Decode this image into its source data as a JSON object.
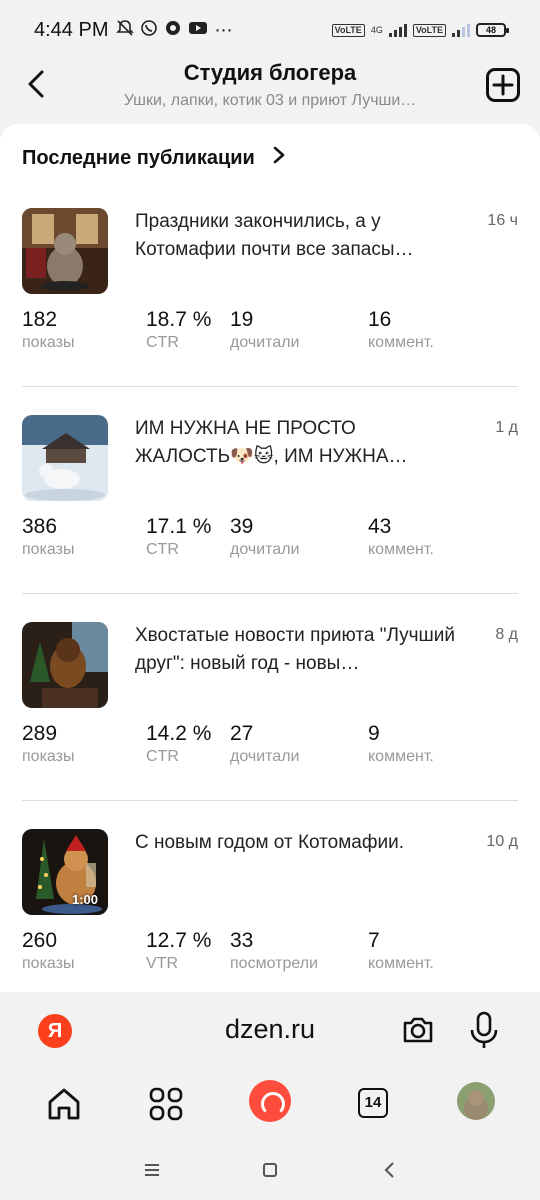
{
  "status_bar": {
    "time": "4:44 PM",
    "lte_label": "Vo LTE",
    "network": "4G",
    "battery": "48"
  },
  "header": {
    "title": "Студия блогера",
    "subtitle": "Ушки, лапки, котик 03 и приют Лучши…"
  },
  "section": {
    "title": "Последние публикации"
  },
  "posts": [
    {
      "title": "Праздники закончились, а у Котомафии почти все запасы…",
      "time": "16 ч",
      "stats": [
        {
          "value": "182",
          "label": "показы"
        },
        {
          "value": "18.7 %",
          "label": "CTR"
        },
        {
          "value": "19",
          "label": "дочитали"
        },
        {
          "value": "16",
          "label": "коммент."
        }
      ]
    },
    {
      "title": "ИМ НУЖНА НЕ ПРОСТО ЖАЛОСТЬ🐶🐱, ИМ НУЖНА…",
      "time": "1 д",
      "stats": [
        {
          "value": "386",
          "label": "показы"
        },
        {
          "value": "17.1 %",
          "label": "CTR"
        },
        {
          "value": "39",
          "label": "дочитали"
        },
        {
          "value": "43",
          "label": "коммент."
        }
      ]
    },
    {
      "title": "Хвостатые новости приюта \"Лучший друг\": новый год - новы…",
      "time": "8 д",
      "stats": [
        {
          "value": "289",
          "label": "показы"
        },
        {
          "value": "14.2 %",
          "label": "CTR"
        },
        {
          "value": "27",
          "label": "дочитали"
        },
        {
          "value": "9",
          "label": "коммент."
        }
      ]
    },
    {
      "title": "С новым годом от Котомафии.",
      "time": "10 д",
      "video_duration": "1:00",
      "stats": [
        {
          "value": "260",
          "label": "показы"
        },
        {
          "value": "12.7 %",
          "label": "VTR"
        },
        {
          "value": "33",
          "label": "посмотрели"
        },
        {
          "value": "7",
          "label": "коммент."
        }
      ]
    }
  ],
  "address_bar": {
    "logo": "Я",
    "url": "dzen.ru"
  },
  "bottom_nav": {
    "tabs_count": "14"
  },
  "colors": {
    "accent": "#fc3f1d",
    "alice": "#ff4d3d",
    "background": "#f2f2f2"
  },
  "icons": [
    "back-arrow",
    "plus-square",
    "chevron-right",
    "camera",
    "microphone",
    "home",
    "services-grid",
    "alice",
    "tabs",
    "avatar"
  ]
}
